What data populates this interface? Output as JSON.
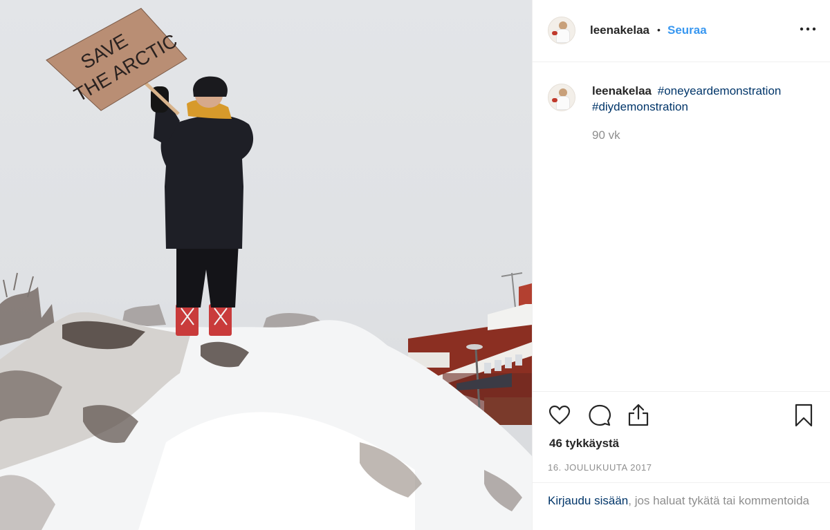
{
  "post": {
    "photo_alt": "",
    "sign_line1": "SAVE",
    "sign_line2": "THE ARCTIC"
  },
  "header": {
    "username": "leenakelaa",
    "separator": "•",
    "follow_label": "Seuraa",
    "more_label": "•••"
  },
  "caption": {
    "username": "leenakelaa",
    "hashtags": [
      "#oneyeardemonstration",
      "#diydemonstration"
    ],
    "time_ago": "90 vk"
  },
  "actions": {
    "icons": [
      "heart-icon",
      "comment-icon",
      "share-icon",
      "bookmark-icon"
    ],
    "likes": "46 tykkäystä",
    "date": "16. JOULUKUUTA 2017"
  },
  "login_prompt": {
    "link_text": "Kirjaudu sisään",
    "rest_text": ", jos haluat tykätä tai kommentoida"
  },
  "colors": {
    "link_blue": "#3897f0",
    "hashtag_blue": "#003569",
    "muted_gray": "#8e8e8e"
  }
}
